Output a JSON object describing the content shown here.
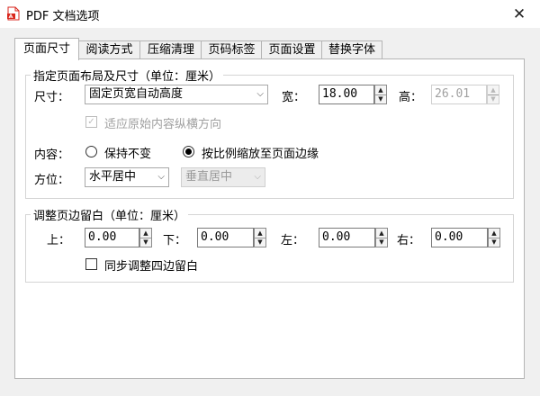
{
  "window": {
    "title": "PDF 文档选项",
    "close_glyph": "✕"
  },
  "tabs": [
    {
      "label": "页面尺寸",
      "active": true
    },
    {
      "label": "阅读方式",
      "active": false
    },
    {
      "label": "压缩清理",
      "active": false
    },
    {
      "label": "页码标签",
      "active": false
    },
    {
      "label": "页面设置",
      "active": false
    },
    {
      "label": "替换字体",
      "active": false
    }
  ],
  "layout_group": {
    "title": "指定页面布局及尺寸（单位：厘米）",
    "size_label": "尺寸：",
    "size_value": "固定页宽自动高度",
    "width_label": "宽：",
    "width_value": "18.00",
    "height_label": "高：",
    "height_value": "26.01",
    "adapt_label": "适应原始内容纵横方向",
    "adapt_checked": true,
    "content_label": "内容：",
    "keep_label": "保持不变",
    "scale_label": "按比例缩放至页面边缘",
    "position_label": "方位：",
    "h_align_value": "水平居中",
    "v_align_value": "垂直居中"
  },
  "margin_group": {
    "title": "调整页边留白（单位：厘米）",
    "top_label": "上：",
    "top_value": "0.00",
    "bottom_label": "下：",
    "bottom_value": "0.00",
    "left_label": "左：",
    "left_value": "0.00",
    "right_label": "右：",
    "right_value": "0.00",
    "sync_label": "同步调整四边留白",
    "sync_checked": false
  },
  "icons": {
    "spin_up": "▲",
    "spin_down": "▼",
    "dropdown": "⌵",
    "check": "✓"
  },
  "colors": {
    "app_icon_red": "#d9261c",
    "panel_bg": "#ffffff",
    "window_bg": "#f0f0f0"
  }
}
